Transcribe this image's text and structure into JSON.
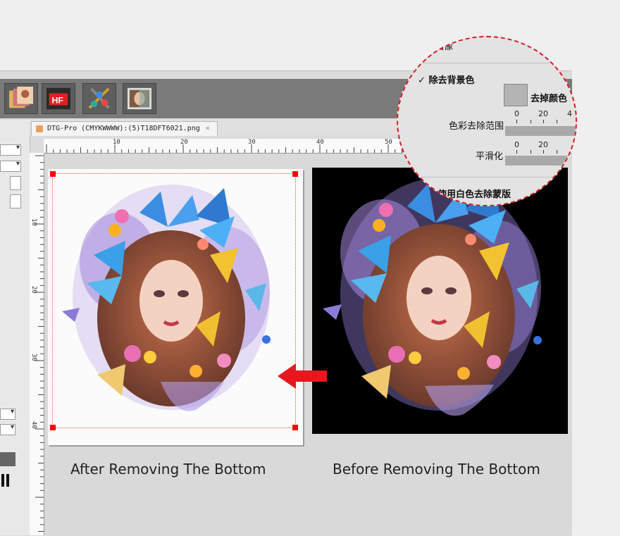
{
  "document_tab": {
    "title": "DTG-Pro (CMYKWWWW):(5)T18DFT6021.png",
    "close": "×"
  },
  "ruler": {
    "top": [
      "10",
      "20",
      "30",
      "40",
      "50"
    ],
    "left": [
      "10",
      "20",
      "30",
      "40"
    ]
  },
  "toolbar_icons": [
    "photo-stack-icon",
    "hf-tool-icon",
    "color-tools-icon",
    "portrait-edit-icon"
  ],
  "captions": {
    "after": "After Removing The Bottom",
    "before": "Before Removing The Bottom"
  },
  "magnifier": {
    "header_fragment": "图像",
    "checkbox_mark": "✓",
    "remove_background": "除去背景色",
    "remove_color": "去掉颜色",
    "color_range_label": "色彩去除范围",
    "smoothing_label": "平滑化",
    "scale": [
      "0",
      "20",
      "4"
    ],
    "white_mask": "使用白色去除蒙版"
  },
  "colors": {
    "accent_red": "#e8171e",
    "magnifier_border": "#d21f2a"
  }
}
